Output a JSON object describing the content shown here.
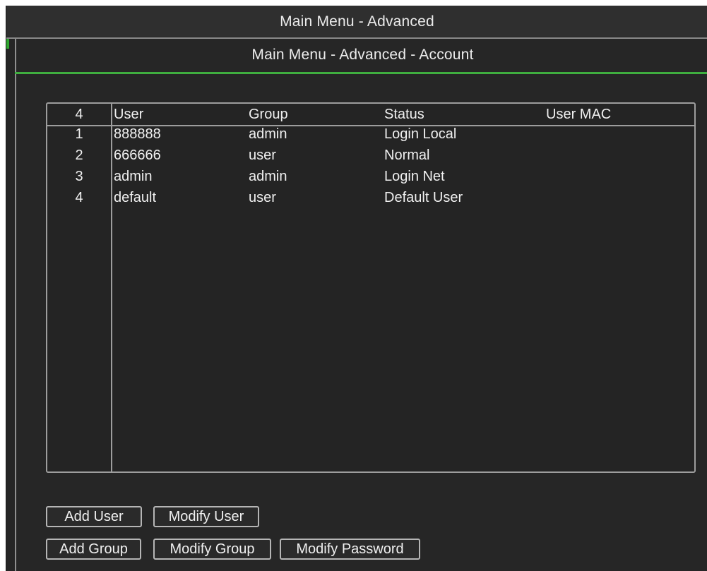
{
  "window": {
    "outer_title": "Main Menu - Advanced",
    "inner_title": "Main Menu - Advanced - Account",
    "accent_color": "#3fae3f"
  },
  "table": {
    "header": {
      "count": "4",
      "user": "User",
      "group": "Group",
      "status": "Status",
      "mac": "User MAC"
    },
    "rows": [
      {
        "num": "1",
        "user": "888888",
        "group": "admin",
        "status": "Login Local",
        "mac": ""
      },
      {
        "num": "2",
        "user": "666666",
        "group": "user",
        "status": "Normal",
        "mac": ""
      },
      {
        "num": "3",
        "user": "admin",
        "group": "admin",
        "status": "Login Net",
        "mac": ""
      },
      {
        "num": "4",
        "user": "default",
        "group": "user",
        "status": "Default User",
        "mac": ""
      }
    ]
  },
  "buttons": {
    "add_user": "Add User",
    "modify_user": "Modify User",
    "add_group": "Add Group",
    "modify_group": "Modify Group",
    "modify_password": "Modify Password"
  }
}
